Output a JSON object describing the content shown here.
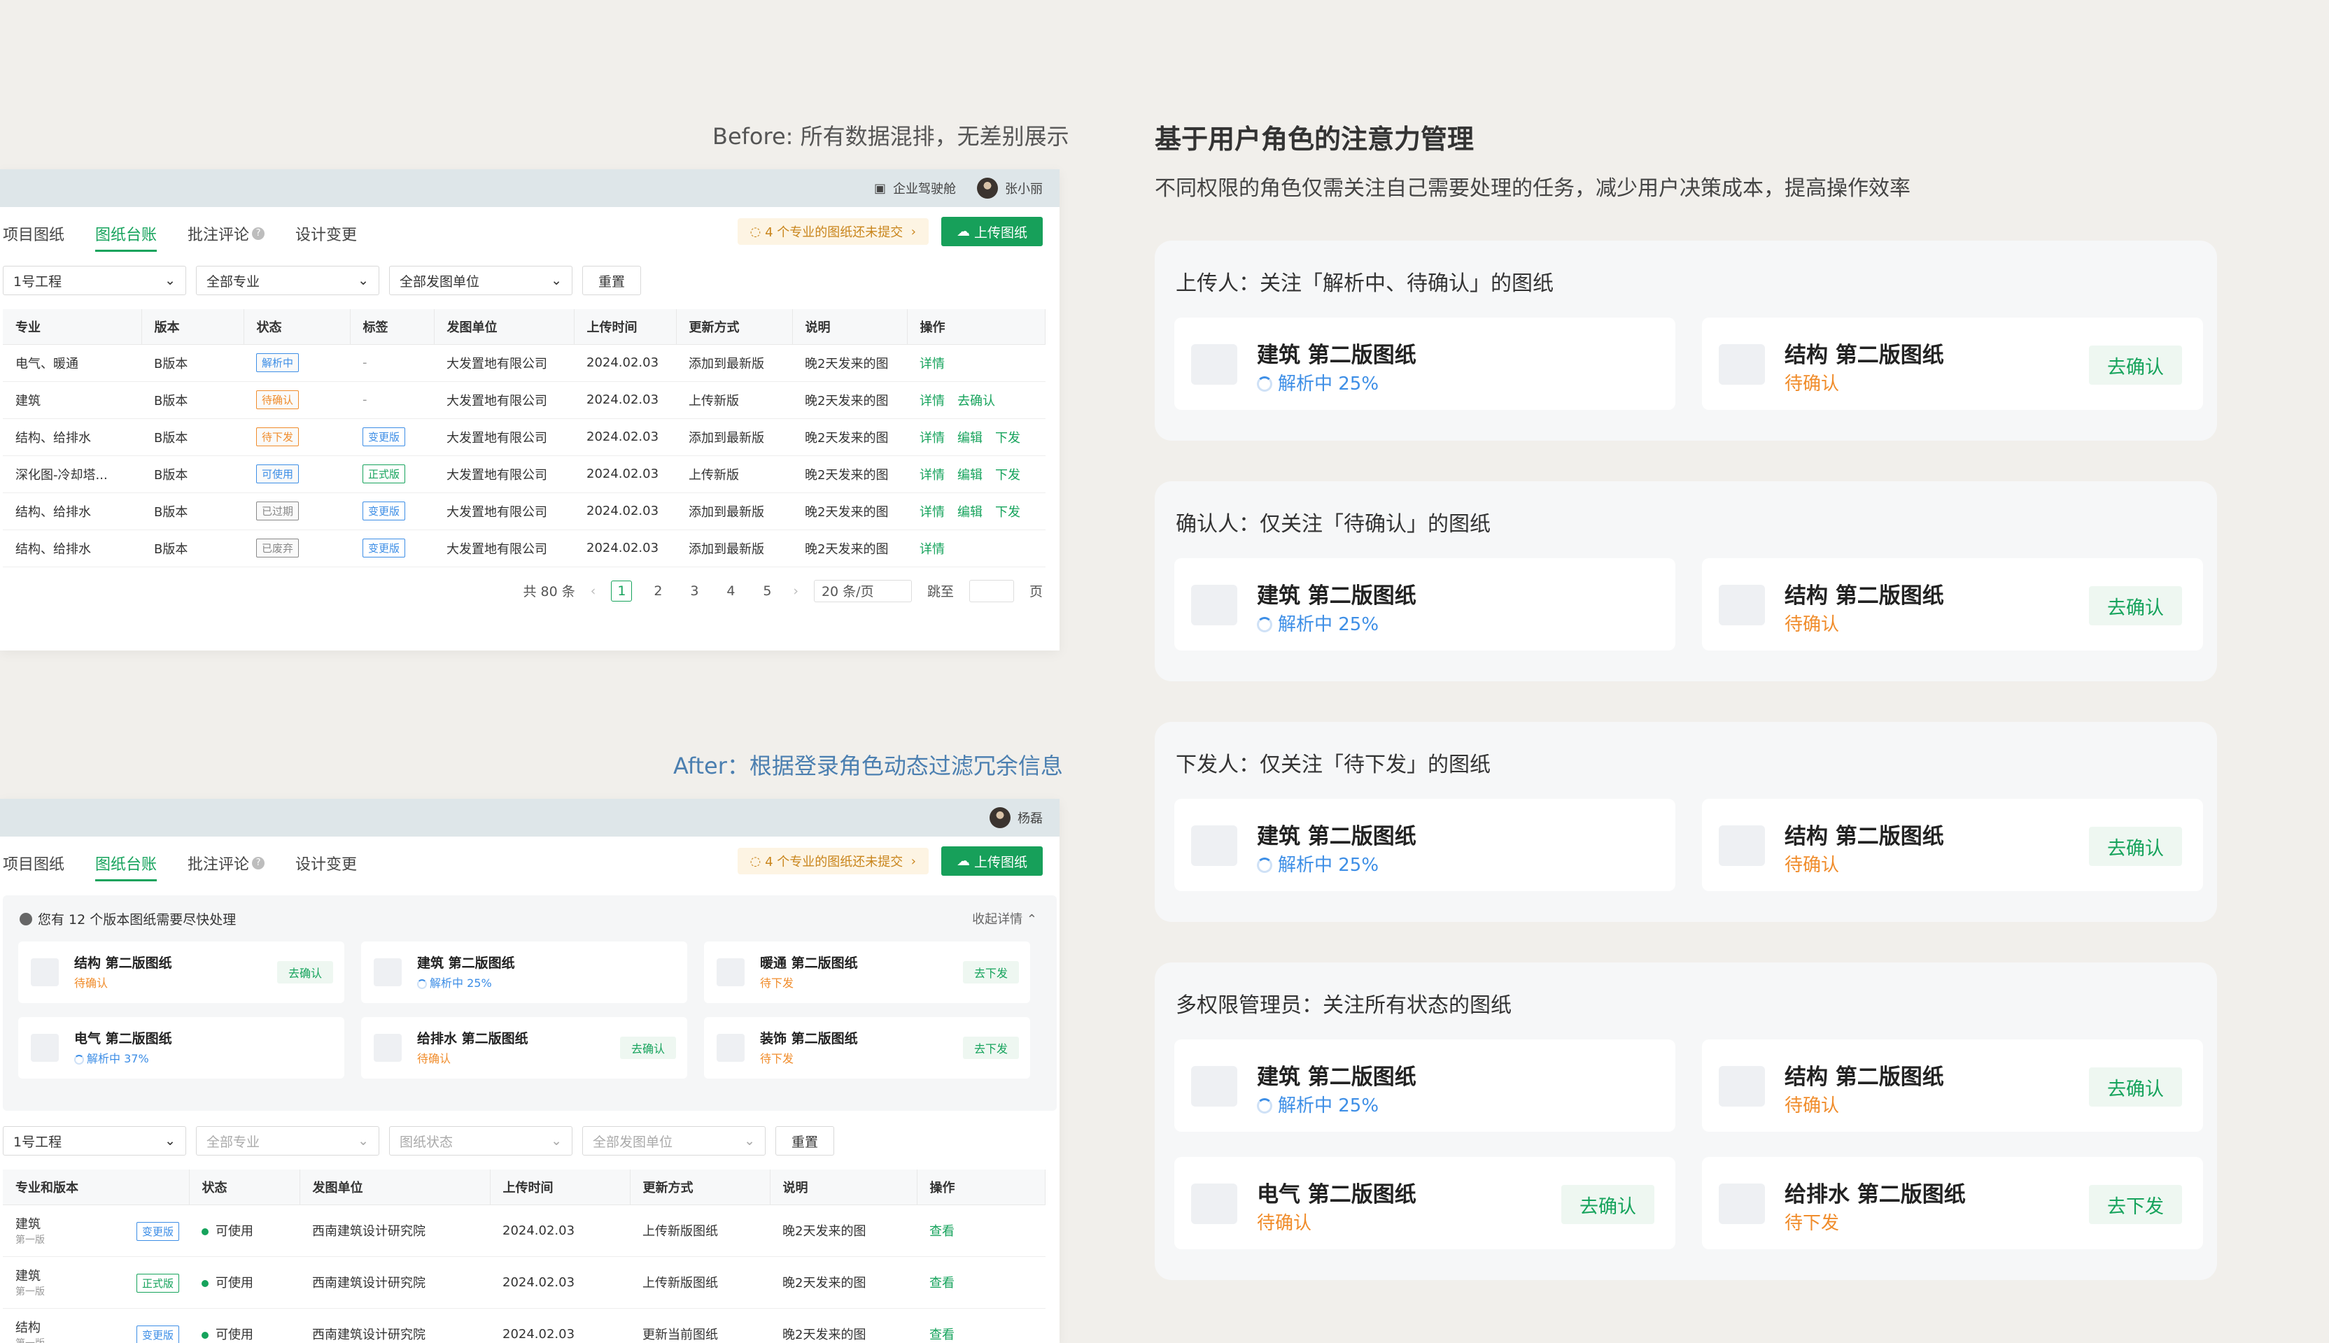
{
  "before": {
    "caption": "Before: 所有数据混排，无差别展示",
    "topbar": {
      "company": "企业驾驶舱",
      "user": "张小丽"
    },
    "tabs": [
      "项目图纸",
      "图纸台账",
      "批注评论",
      "设计变更"
    ],
    "notice": "4 个专业的图纸还未提交",
    "upload": "上传图纸",
    "filters": [
      "1号工程",
      "全部专业",
      "全部发图单位"
    ],
    "reset": "重置",
    "columns": [
      "专业",
      "版本",
      "状态",
      "标签",
      "发图单位",
      "上传时间",
      "更新方式",
      "说明",
      "操作"
    ],
    "rows": [
      {
        "major": "电气、暖通",
        "version": "B版本",
        "status": "解析中",
        "sc": "#3d8ee6",
        "tag": "-",
        "unit": "大发置地有限公司",
        "time": "2024.02.03",
        "mode": "添加到最新版",
        "note": "晚2天发来的图",
        "ops": [
          "详情"
        ]
      },
      {
        "major": "建筑",
        "version": "B版本",
        "status": "待确认",
        "sc": "#f08c2b",
        "tag": "-",
        "unit": "大发置地有限公司",
        "time": "2024.02.03",
        "mode": "上传新版",
        "note": "晚2天发来的图",
        "ops": [
          "详情",
          "去确认"
        ]
      },
      {
        "major": "结构、给排水",
        "version": "B版本",
        "status": "待下发",
        "sc": "#f08c2b",
        "tag": "变更版",
        "tc": "#3d8ee6",
        "unit": "大发置地有限公司",
        "time": "2024.02.03",
        "mode": "添加到最新版",
        "note": "晚2天发来的图",
        "ops": [
          "详情",
          "编辑",
          "下发"
        ]
      },
      {
        "major": "深化图-冷却塔...",
        "version": "B版本",
        "status": "可使用",
        "sc": "#3d8ee6",
        "tag": "正式版",
        "tc": "#16a35c",
        "unit": "大发置地有限公司",
        "time": "2024.02.03",
        "mode": "上传新版",
        "note": "晚2天发来的图",
        "ops": [
          "详情",
          "编辑",
          "下发"
        ]
      },
      {
        "major": "结构、给排水",
        "version": "B版本",
        "status": "已过期",
        "sc": "#888",
        "tag": "变更版",
        "tc": "#3d8ee6",
        "unit": "大发置地有限公司",
        "time": "2024.02.03",
        "mode": "添加到最新版",
        "note": "晚2天发来的图",
        "ops": [
          "详情",
          "编辑",
          "下发"
        ]
      },
      {
        "major": "结构、给排水",
        "version": "B版本",
        "status": "已废弃",
        "sc": "#888",
        "tag": "变更版",
        "tc": "#3d8ee6",
        "unit": "大发置地有限公司",
        "time": "2024.02.03",
        "mode": "添加到最新版",
        "note": "晚2天发来的图",
        "ops": [
          "详情"
        ]
      }
    ],
    "pager": {
      "total": "共 80 条",
      "pages": [
        "1",
        "2",
        "3",
        "4",
        "5"
      ],
      "size": "20 条/页",
      "jump": "跳至",
      "page": "页"
    }
  },
  "after": {
    "caption": "After：根据登录角色动态过滤冗余信息",
    "topbar": {
      "user": "杨磊"
    },
    "tabs": [
      "项目图纸",
      "图纸台账",
      "批注评论",
      "设计变更"
    ],
    "notice": "4 个专业的图纸还未提交",
    "upload": "上传图纸",
    "todo": {
      "head": "您有 12 个版本图纸需要尽快处理",
      "more": "收起详情",
      "items": [
        {
          "title": "结构 第二版图纸",
          "status": "待确认",
          "kind": "orange",
          "action": "去确认"
        },
        {
          "title": "建筑 第二版图纸",
          "status": "解析中 25%",
          "kind": "blue",
          "action": ""
        },
        {
          "title": "暖通 第二版图纸",
          "status": "待下发",
          "kind": "orange",
          "action": "去下发"
        },
        {
          "title": "电气 第二版图纸",
          "status": "解析中 37%",
          "kind": "blue",
          "action": ""
        },
        {
          "title": "给排水 第二版图纸",
          "status": "待确认",
          "kind": "orange",
          "action": "去确认"
        },
        {
          "title": "装饰 第二版图纸",
          "status": "待下发",
          "kind": "orange",
          "action": "去下发"
        }
      ]
    },
    "filters": [
      "1号工程",
      "全部专业",
      "图纸状态",
      "全部发图单位"
    ],
    "reset": "重置",
    "columns": [
      "专业和版本",
      "状态",
      "发图单位",
      "上传时间",
      "更新方式",
      "说明",
      "操作"
    ],
    "rows": [
      {
        "major": "建筑",
        "sub": "第一版",
        "tag": "变更版",
        "tc": "#3d8ee6",
        "status": "可使用",
        "unit": "西南建筑设计研究院",
        "time": "2024.02.03",
        "mode": "上传新版图纸",
        "note": "晚2天发来的图",
        "op": "查看"
      },
      {
        "major": "建筑",
        "sub": "第一版",
        "tag": "正式版",
        "tc": "#16a35c",
        "status": "可使用",
        "unit": "西南建筑设计研究院",
        "time": "2024.02.03",
        "mode": "上传新版图纸",
        "note": "晚2天发来的图",
        "op": "查看"
      },
      {
        "major": "结构",
        "sub": "第一版",
        "tag": "变更版",
        "tc": "#3d8ee6",
        "status": "可使用",
        "unit": "西南建筑设计研究院",
        "time": "2024.02.03",
        "mode": "更新当前图纸",
        "note": "晚2天发来的图",
        "op": "查看"
      }
    ]
  },
  "right": {
    "title": "基于用户角色的注意力管理",
    "subtitle": "不同权限的角色仅需关注自己需要处理的任务，减少用户决策成本，提高操作效率",
    "sections": [
      {
        "title": "上传人：关注「解析中、待确认」的图纸",
        "cards": [
          {
            "title": "建筑 第二版图纸",
            "status": "解析中 25%",
            "kind": "blue",
            "action": ""
          },
          {
            "title": "结构 第二版图纸",
            "status": "待确认",
            "kind": "orange",
            "action": "去确认"
          }
        ]
      },
      {
        "title": "确认人：仅关注「待确认」的图纸",
        "cards": [
          {
            "title": "建筑 第二版图纸",
            "status": "解析中 25%",
            "kind": "blue",
            "action": ""
          },
          {
            "title": "结构 第二版图纸",
            "status": "待确认",
            "kind": "orange",
            "action": "去确认"
          }
        ]
      },
      {
        "title": "下发人：仅关注「待下发」的图纸",
        "cards": [
          {
            "title": "建筑 第二版图纸",
            "status": "解析中 25%",
            "kind": "blue",
            "action": ""
          },
          {
            "title": "结构 第二版图纸",
            "status": "待确认",
            "kind": "orange",
            "action": "去确认"
          }
        ]
      },
      {
        "title": "多权限管理员：关注所有状态的图纸",
        "cards": [
          {
            "title": "建筑 第二版图纸",
            "status": "解析中 25%",
            "kind": "blue",
            "action": ""
          },
          {
            "title": "结构 第二版图纸",
            "status": "待确认",
            "kind": "orange",
            "action": "去确认"
          },
          {
            "title": "电气 第二版图纸",
            "status": "待确认",
            "kind": "orange",
            "action": "去确认"
          },
          {
            "title": "给排水 第二版图纸",
            "status": "待下发",
            "kind": "orange",
            "action": "去下发"
          }
        ]
      }
    ]
  },
  "colors": {
    "accent": "#16a35c",
    "orange": "#f08c2b",
    "blue": "#3d8ee6"
  }
}
